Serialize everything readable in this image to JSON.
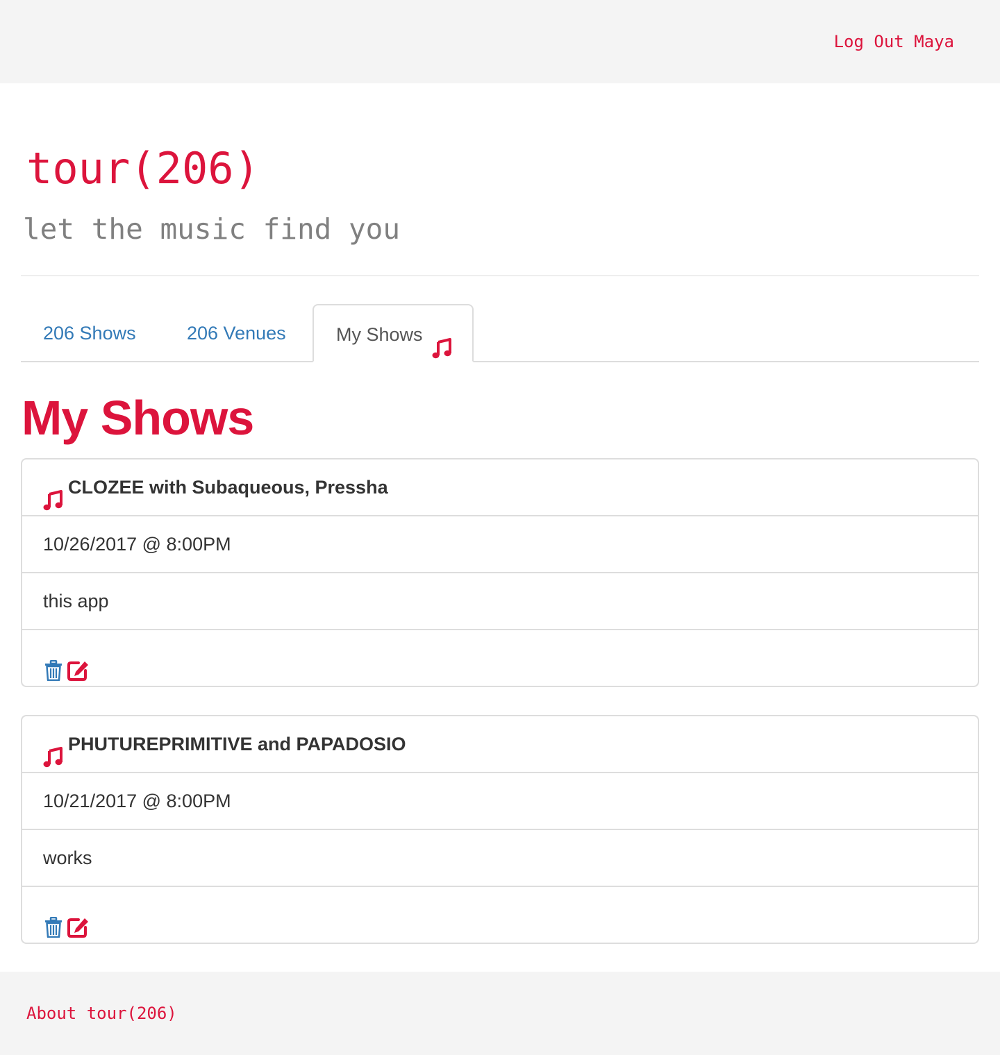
{
  "colors": {
    "accent": "#dc143c",
    "link": "#337ab7",
    "muted": "#808080"
  },
  "nav": {
    "logout_label": "Log Out Maya"
  },
  "brand": {
    "title": "tour(206)",
    "tagline": "let the music find you"
  },
  "tabs": [
    {
      "label": "206 Shows",
      "active": false
    },
    {
      "label": "206 Venues",
      "active": false
    },
    {
      "label": "My Shows",
      "active": true,
      "icon": "music-note-icon"
    }
  ],
  "main": {
    "heading": "My Shows",
    "shows": [
      {
        "icon": "music-note-icon",
        "title": "CLOZEE with Subaqueous, Pressha",
        "datetime": "10/26/2017 @ 8:00PM",
        "note": "this app",
        "actions": [
          "trash-icon",
          "edit-icon"
        ]
      },
      {
        "icon": "music-note-icon",
        "title": "PHUTUREPRIMITIVE and PAPADOSIO",
        "datetime": "10/21/2017 @ 8:00PM",
        "note": "works",
        "actions": [
          "trash-icon",
          "edit-icon"
        ]
      }
    ]
  },
  "footer": {
    "about_label": "About tour(206)"
  }
}
